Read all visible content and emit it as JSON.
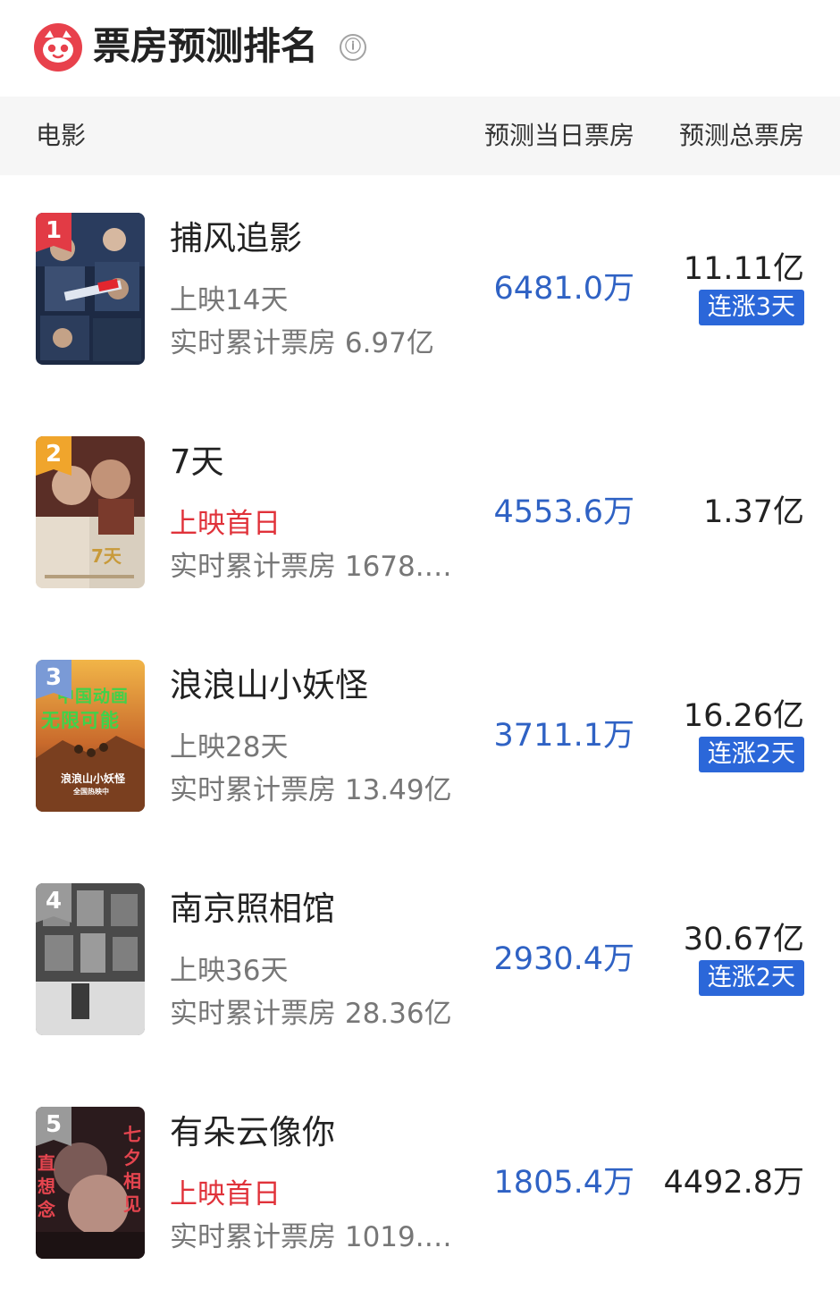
{
  "header": {
    "title": "票房预测排名",
    "info_icon": "ⓘ"
  },
  "columns": {
    "movie": "电影",
    "daily_forecast": "预测当日票房",
    "total_forecast": "预测总票房"
  },
  "colors": {
    "accent_blue": "#2f62c4",
    "streak_bg": "#2b67d9",
    "first_day_red": "#e0323a",
    "logo_red": "#e8414c",
    "rank_1": "#e23b45",
    "rank_2": "#f0a52c",
    "rank_3": "#7a9ad6",
    "rank_4": "#9a9a9a",
    "rank_5": "#9a9a9a"
  },
  "movies": [
    {
      "rank": "1",
      "name": "捕风追影",
      "release": "上映14天",
      "cumulative": "实时累计票房 6.97亿",
      "daily": "6481.0万",
      "total": "11.11亿",
      "streak": "连涨3天"
    },
    {
      "rank": "2",
      "name": "7天",
      "release": "上映首日",
      "cumulative": "实时累计票房 1678.0…",
      "daily": "4553.6万",
      "total": "1.37亿",
      "streak": "",
      "poster_text": "7天"
    },
    {
      "rank": "3",
      "name": "浪浪山小妖怪",
      "release": "上映28天",
      "cumulative": "实时累计票房 13.49亿",
      "daily": "3711.1万",
      "total": "16.26亿",
      "streak": "连涨2天",
      "poster_text_top": "中国动画",
      "poster_text_mid": "无限可能",
      "poster_text_bottom": "浪浪山小妖怪",
      "poster_text_small": "全国热映中"
    },
    {
      "rank": "4",
      "name": "南京照相馆",
      "release": "上映36天",
      "cumulative": "实时累计票房 28.36亿",
      "daily": "2930.4万",
      "total": "30.67亿",
      "streak": "连涨2天"
    },
    {
      "rank": "5",
      "name": "有朵云像你",
      "release": "上映首日",
      "cumulative": "实时累计票房 1019.0…",
      "daily": "1805.4万",
      "total": "4492.8万",
      "streak": "",
      "poster_text_right": "七夕相见",
      "poster_text_left": "直想念"
    }
  ]
}
